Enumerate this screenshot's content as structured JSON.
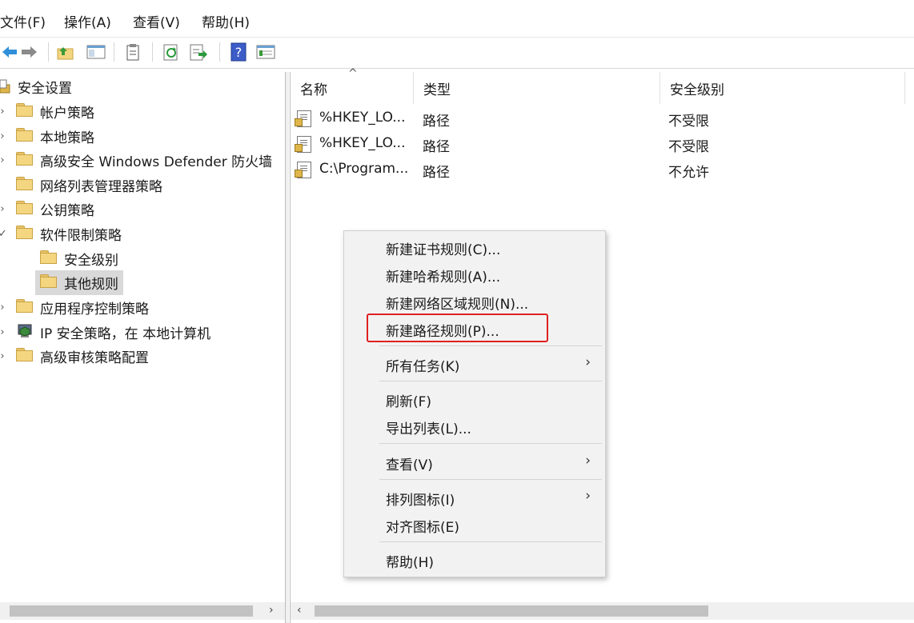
{
  "menu": [
    "文件(F)",
    "操作(A)",
    "查看(V)",
    "帮助(H)"
  ],
  "toolbar": [
    "back-arrow-icon",
    "forward-arrow-icon",
    "up-folder-icon",
    "show-hide-tree-icon",
    "clipboard-icon",
    "refresh-icon",
    "export-list-icon",
    "help-icon",
    "properties-view-icon"
  ],
  "tree": {
    "root": "安全设置",
    "items": [
      {
        "label": "帐户策略"
      },
      {
        "label": "本地策略"
      },
      {
        "label": "高级安全 Windows Defender 防火墙"
      },
      {
        "label": "网络列表管理器策略"
      },
      {
        "label": "公钥策略"
      },
      {
        "label": "软件限制策略"
      },
      {
        "label": "安全级别"
      },
      {
        "label": "其他规则"
      },
      {
        "label": "应用程序控制策略"
      },
      {
        "label": "IP 安全策略，在 本地计算机"
      },
      {
        "label": "高级审核策略配置"
      }
    ]
  },
  "table": {
    "headers": [
      "名称",
      "类型",
      "安全级别"
    ],
    "rows": [
      {
        "name": "%HKEY_LO...",
        "type": "路径",
        "level": "不受限"
      },
      {
        "name": "%HKEY_LO...",
        "type": "路径",
        "level": "不受限"
      },
      {
        "name": "C:\\Program...",
        "type": "路径",
        "level": "不允许"
      }
    ]
  },
  "context_menu": {
    "items": [
      {
        "label": "新建证书规则(C)..."
      },
      {
        "label": "新建哈希规则(A)..."
      },
      {
        "label": "新建网络区域规则(N)..."
      },
      {
        "label": "新建路径规则(P)..."
      },
      {
        "label": "所有任务(K)",
        "submenu": "›"
      },
      {
        "label": "刷新(F)"
      },
      {
        "label": "导出列表(L)..."
      },
      {
        "label": "查看(V)",
        "submenu": "›"
      },
      {
        "label": "排列图标(I)",
        "submenu": "›"
      },
      {
        "label": "对齐图标(E)"
      },
      {
        "label": "帮助(H)"
      }
    ],
    "highlighted": "新建路径规则(P)..."
  },
  "scroll": {
    "left_arrow": "‹",
    "right_arrow": "›",
    "sort_indicator": "^"
  }
}
